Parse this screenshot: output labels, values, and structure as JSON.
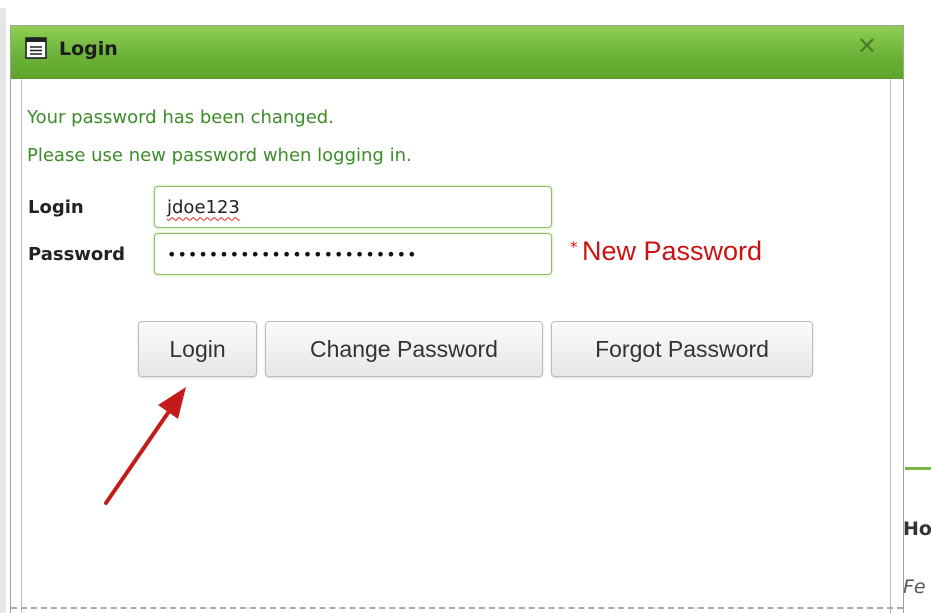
{
  "dialog": {
    "title": "Login",
    "title_icon": "window-icon",
    "close_glyph": "✕"
  },
  "messages": {
    "line1": "Your password has been changed.",
    "line2": "Please use new password when logging in."
  },
  "form": {
    "login_label": "Login",
    "login_value": "jdoe123",
    "password_label": "Password",
    "password_value": "••••••••••••••••••••••••",
    "required_mark": "*",
    "password_hint": "New Password"
  },
  "buttons": {
    "login": "Login",
    "change_password": "Change Password",
    "forgot_password": "Forgot Password"
  },
  "background": {
    "fragment1": "Ho",
    "fragment2": "Fe"
  },
  "colors": {
    "titlebar": "#6db33a",
    "message_text": "#3c8c28",
    "hint_text": "#cc1111",
    "annotation_arrow": "#c41a1a"
  },
  "annotation": {
    "arrow_icon": "arrow-pointer-icon"
  }
}
